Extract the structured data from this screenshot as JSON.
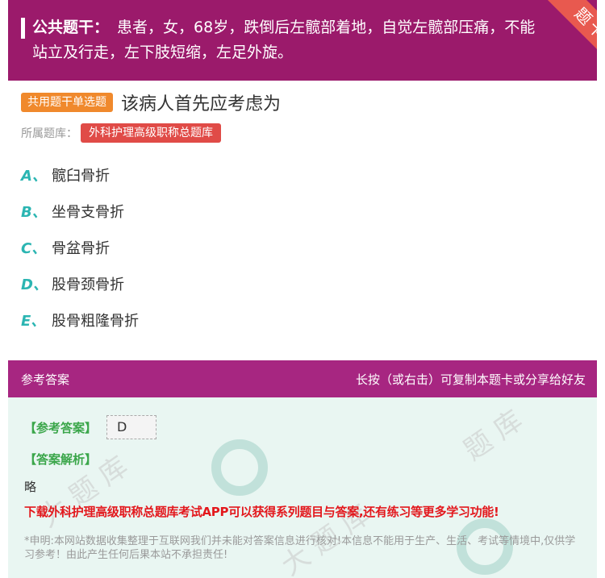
{
  "stem": {
    "label": "公共题干：",
    "text": "患者，女，68岁，跌倒后左髋部着地，自觉左髋部压痛，不能站立及行走，左下肢短缩，左足外旋。"
  },
  "ribbon": {
    "text": "题卡"
  },
  "question": {
    "type_badge": "共用题干单选题",
    "title": "该病人首先应考虑为",
    "library_label": "所属题库：",
    "library_name": "外科护理高级职称总题库"
  },
  "options": [
    {
      "letter": "A、",
      "text": "髋臼骨折"
    },
    {
      "letter": "B、",
      "text": "坐骨支骨折"
    },
    {
      "letter": "C、",
      "text": "骨盆骨折"
    },
    {
      "letter": "D、",
      "text": "股骨颈骨折"
    },
    {
      "letter": "E、",
      "text": "股骨粗隆骨折"
    }
  ],
  "answer_header": {
    "left": "参考答案",
    "right": "长按（或右击）可复制本题卡或分享给好友"
  },
  "answer": {
    "ref_label": "【参考答案】",
    "ref_value": "D",
    "expl_label": "【答案解析】",
    "expl_text": "略",
    "promo": "下载外科护理高级职称总题库考试APP可以获得系列题目与答案,还有练习等更多学习功能!",
    "disclaimer": "*申明:本网站数据收集整理于互联网我们并未能对答案信息进行核对!本信息不能用于生产、生活、考试等情境中,仅供学习参考！由此产生任何后果本站不承担责任!"
  },
  "colors": {
    "stem_bg": "#9b1a6b",
    "answer_header_bg": "#a72681",
    "ribbon": "#e8594f",
    "type_badge": "#f0892c",
    "library_badge": "#e04b47",
    "option_letter": "#2bb5b2",
    "answer_body_bg": "#e9f6f2",
    "promo": "#e3181d"
  }
}
